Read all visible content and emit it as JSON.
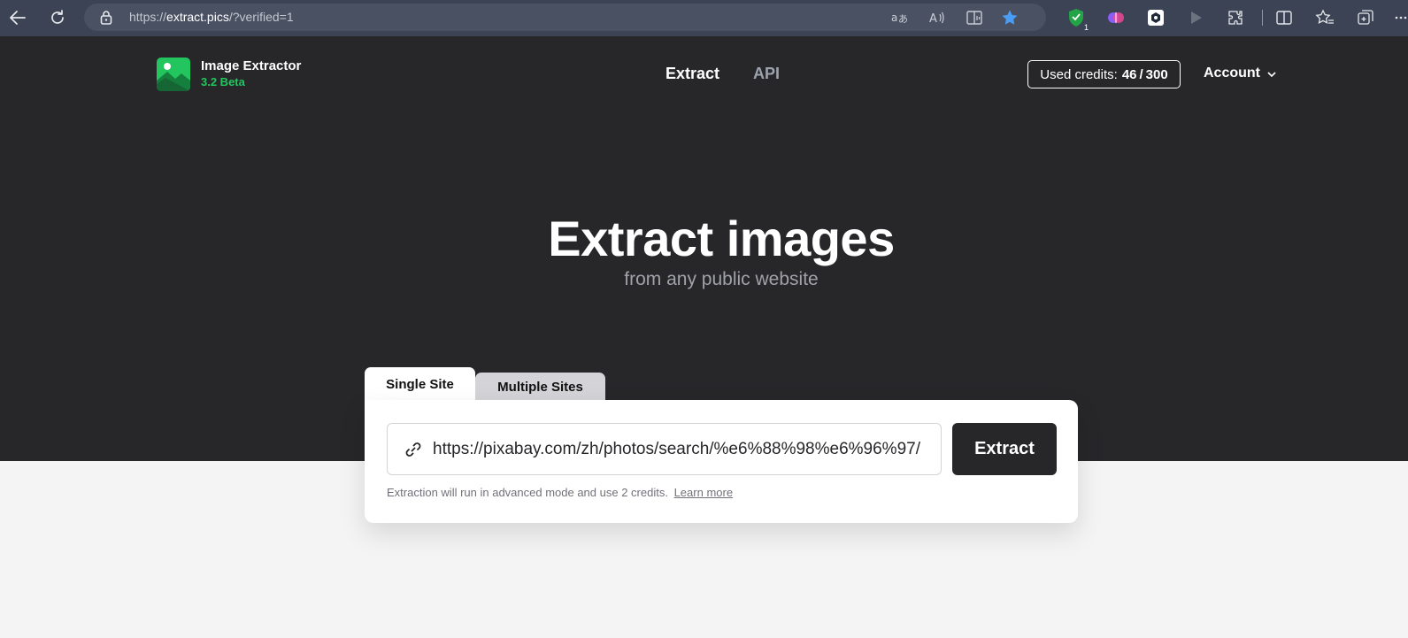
{
  "browser": {
    "url_prefix": "https://",
    "url_host": "extract.pics",
    "url_path": "/?verified=1",
    "extension_badge": "1",
    "colors": {
      "toolbar": "#3b4354",
      "urlbar": "#4a5162",
      "favorite_star": "#4a9df5"
    },
    "icons": [
      "back-icon",
      "refresh-icon",
      "lock-icon",
      "translate-icon",
      "read-aloud-icon",
      "immersive-reader-icon",
      "favorite-star-icon",
      "shield-extension-icon",
      "brain-extension-icon",
      "dark-extension-icon",
      "play-extension-icon",
      "extensions-icon",
      "split-screen-icon",
      "favorites-icon",
      "collections-icon",
      "more-icon"
    ]
  },
  "site": {
    "brand": {
      "name": "Image Extractor",
      "version": "3.2 Beta"
    },
    "nav": {
      "extract": "Extract",
      "api": "API"
    },
    "credits": {
      "label": "Used credits:",
      "value": "46 / 300"
    },
    "account": {
      "label": "Account"
    },
    "hero": {
      "title": "Extract images",
      "subtitle": "from any public website"
    },
    "tabs": {
      "single": "Single Site",
      "multiple": "Multiple Sites"
    },
    "form": {
      "url_value": "https://pixabay.com/zh/photos/search/%e6%88%98%e6%96%97/",
      "extract_button": "Extract",
      "note": "Extraction will run in advanced mode and use 2 credits.",
      "learn_more": "Learn more"
    },
    "colors": {
      "hero_bg": "#27272a",
      "accent": "#22c55e",
      "page_bg": "#f4f4f4"
    }
  }
}
